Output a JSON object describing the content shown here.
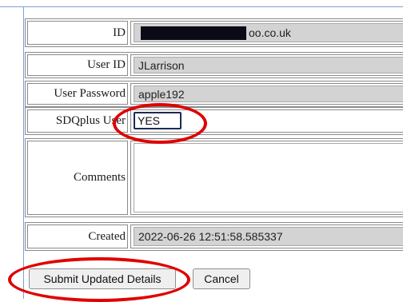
{
  "form": {
    "id": {
      "label": "ID",
      "value_suffix": "oo.co.uk"
    },
    "user_id": {
      "label": "User ID",
      "value": "JLarrison"
    },
    "user_password": {
      "label": "User Password",
      "value": "apple192"
    },
    "sdqplus_user": {
      "label": "SDQplus User",
      "value": "YES"
    },
    "comments": {
      "label": "Comments",
      "value": ""
    },
    "created": {
      "label": "Created",
      "value": "2022-06-26 12:51:58.585337"
    }
  },
  "buttons": {
    "submit_label": "Submit Updated Details",
    "cancel_label": "Cancel"
  },
  "annotations": {
    "color": "#e00000"
  }
}
